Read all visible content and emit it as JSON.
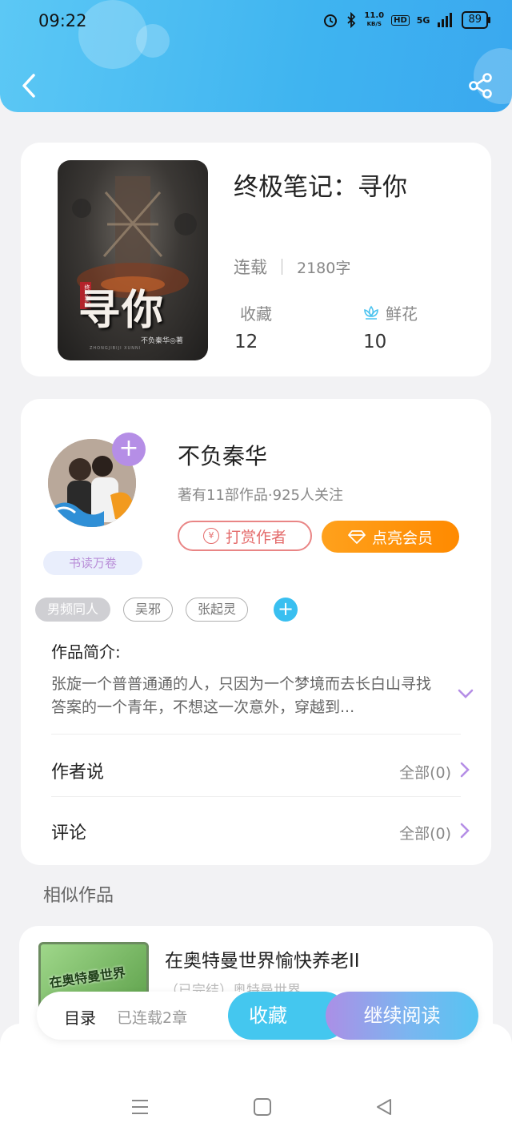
{
  "status_bar": {
    "time": "09:22",
    "speed": "11.0",
    "speed_unit": "KB/S",
    "hd": "HD",
    "network": "5G",
    "battery": "89"
  },
  "book": {
    "title": "终极笔记：寻你",
    "status": "连载",
    "word_count": "2180字",
    "collect_label": "收藏",
    "collect_count": "12",
    "flower_label": "鲜花",
    "flower_count": "10",
    "cover": {
      "title": "寻你",
      "series": "终极笔记",
      "author": "不负秦华◎著",
      "pinyin": "ZHONGJIBIJI XUNNI"
    }
  },
  "author": {
    "name": "不负秦华",
    "stats": "著有11部作品·925人关注",
    "tip_label": "打赏作者",
    "vip_label": "点亮会员",
    "badge": "书读万卷"
  },
  "tags": [
    "男频同人",
    "吴邪",
    "张起灵"
  ],
  "intro": {
    "label": "作品简介:",
    "text": "张旋一个普普通通的人，只因为一个梦境而去长白山寻找答案的一个青年，不想这一次意外，穿越到..."
  },
  "rows": [
    {
      "label": "作者说",
      "value": "全部(0)"
    },
    {
      "label": "评论",
      "value": "全部(0)"
    }
  ],
  "similar": {
    "section_title": "相似作品",
    "items": [
      {
        "title": "在奥特曼世界愉快养老II",
        "cover_text": "在奥特曼世界",
        "desc": "（已完结）奥特曼世界…"
      }
    ]
  },
  "bottom_bar": {
    "toc_label": "目录",
    "serial_label": "已连载2章",
    "favorite_label": "收藏",
    "read_label": "继续阅读"
  },
  "colors": {
    "header": "#3fb4f0",
    "accent": "#44c7ef",
    "vip": "#ff9a0f",
    "tip": "#e46b6b",
    "purple": "#b58ee6"
  },
  "icons": [
    "back-icon",
    "share-icon",
    "flower-icon",
    "plus-icon",
    "yen-icon",
    "diamond-icon",
    "chevron-down-icon",
    "chevron-right-icon",
    "menu-icon",
    "home-icon",
    "back-triangle-icon"
  ]
}
